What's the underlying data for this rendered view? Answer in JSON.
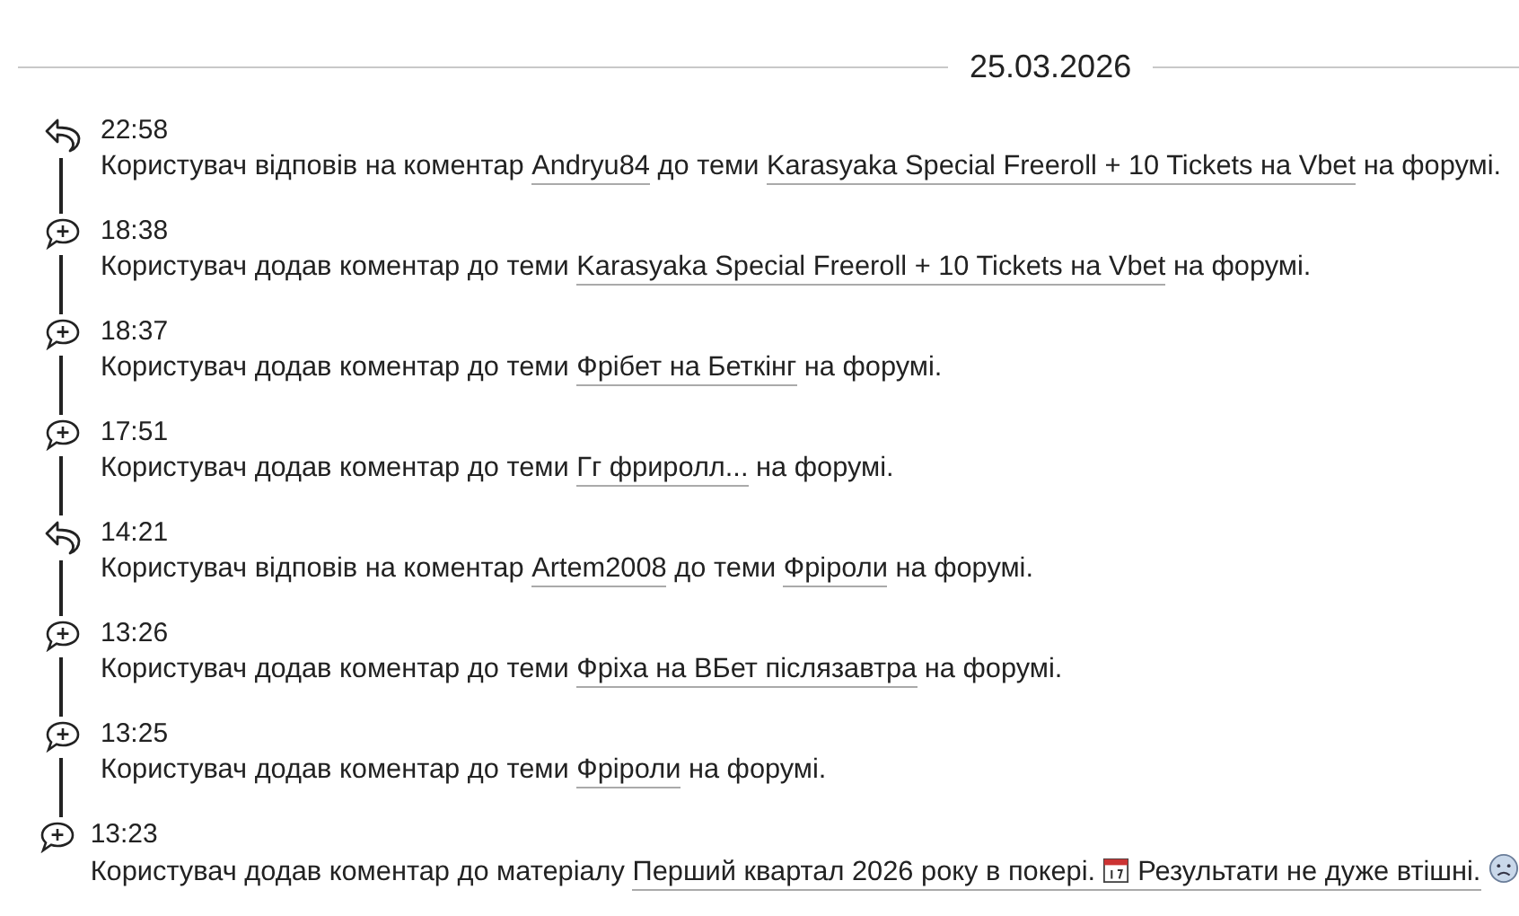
{
  "date": "25.03.2026",
  "events": [
    {
      "kind": "reply",
      "time": "22:58",
      "segments": [
        {
          "kind": "text",
          "text": "Користувач відповів на коментар"
        },
        {
          "kind": "link",
          "text": "Andryu84"
        },
        {
          "kind": "text",
          "text": "до теми"
        },
        {
          "kind": "link",
          "text": "Karasyaka Special Freeroll + 10 Tickets на Vbet"
        },
        {
          "kind": "text",
          "text": "на форумі."
        }
      ]
    },
    {
      "kind": "comment",
      "time": "18:38",
      "segments": [
        {
          "kind": "text",
          "text": "Користувач додав коментар до теми"
        },
        {
          "kind": "link",
          "text": "Karasyaka Special Freeroll + 10 Tickets на Vbet"
        },
        {
          "kind": "text",
          "text": "на форумі."
        }
      ]
    },
    {
      "kind": "comment",
      "time": "18:37",
      "segments": [
        {
          "kind": "text",
          "text": "Користувач додав коментар до теми"
        },
        {
          "kind": "link",
          "text": "Фрібет на Беткінг"
        },
        {
          "kind": "text",
          "text": "на форумі."
        }
      ]
    },
    {
      "kind": "comment",
      "time": "17:51",
      "segments": [
        {
          "kind": "text",
          "text": "Користувач додав коментар до теми"
        },
        {
          "kind": "link",
          "text": "Гг фриролл..."
        },
        {
          "kind": "text",
          "text": "на форумі."
        }
      ]
    },
    {
      "kind": "reply",
      "time": "14:21",
      "segments": [
        {
          "kind": "text",
          "text": "Користувач відповів на коментар"
        },
        {
          "kind": "link",
          "text": "Artem2008"
        },
        {
          "kind": "text",
          "text": "до теми"
        },
        {
          "kind": "link",
          "text": "Фріроли"
        },
        {
          "kind": "text",
          "text": "на форумі."
        }
      ]
    },
    {
      "kind": "comment",
      "time": "13:26",
      "segments": [
        {
          "kind": "text",
          "text": "Користувач додав коментар до теми"
        },
        {
          "kind": "link",
          "text": "Фріха на ВБет післязавтра"
        },
        {
          "kind": "text",
          "text": "на форумі."
        }
      ]
    },
    {
      "kind": "comment",
      "time": "13:25",
      "segments": [
        {
          "kind": "text",
          "text": "Користувач додав коментар до теми"
        },
        {
          "kind": "link",
          "text": "Фріроли"
        },
        {
          "kind": "text",
          "text": "на форумі."
        }
      ]
    },
    {
      "kind": "comment",
      "time": "13:23",
      "segments": [
        {
          "kind": "text",
          "text": "Користувач додав коментар до матеріалу"
        },
        {
          "kind": "link",
          "text": "Перший квартал 2026 року в покері.",
          "calendar": true,
          "text_after": "Результати не дуже втішні."
        },
        {
          "kind": "emoji"
        }
      ]
    }
  ]
}
